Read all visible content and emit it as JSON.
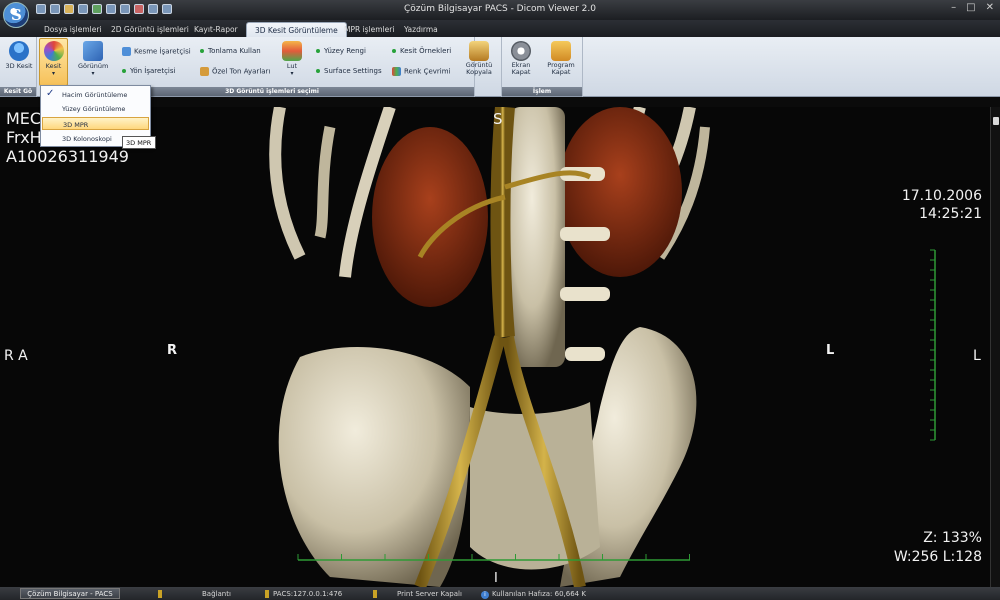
{
  "window": {
    "title": "Çözüm Bilgisayar PACS - Dicom Viewer 2.0",
    "controls": [
      "–",
      "□",
      "✕"
    ]
  },
  "tabs": [
    {
      "label": "Dosya işlemleri",
      "active": false
    },
    {
      "label": "2D Görüntü işlemleri",
      "active": false
    },
    {
      "label": "Kayıt-Rapor",
      "active": false
    },
    {
      "label": "3D Kesit Görüntüleme",
      "active": true
    },
    {
      "label": "MPR işlemleri",
      "active": false
    },
    {
      "label": "Yazdırma",
      "active": false
    }
  ],
  "ribbon": {
    "btn_3d_kesit": "3D Kesit",
    "btn_kesit": "Kesit",
    "btn_gorunum": "Görünüm",
    "kesme_isaretcisi": "Kesme İşaretçisi",
    "yon_isaretcisi": "Yön İşaretçisi",
    "tonlama_kullan": "Tonlama Kullan",
    "ozel_ton_ayarlari": "Özel Ton Ayarları",
    "btn_lut": "Lut",
    "yuzey_rengi": "Yüzey Rengi",
    "surface_settings": "Surface Settings",
    "kesit_ornekleri": "Kesit Örnekleri",
    "renk_cevrimi": "Renk Çevrimi",
    "btn_goruntu_kopyala": "Görüntü Kopyala",
    "btn_ekran_kapat": "Ekran Kapat",
    "btn_program_kapat": "Program Kapat",
    "group_kesit_label": "Kesit Gö",
    "group_3d_label": "3D Görüntü işlemleri seçimi",
    "group_islem_label": "İşlem"
  },
  "dropdown": {
    "items": [
      {
        "label": "Hacim Görüntüleme",
        "checked": true
      },
      {
        "label": "Yüzey Görüntüleme",
        "checked": false
      },
      {
        "label": "3D MPR",
        "checked": false,
        "hover": true
      },
      {
        "label": "3D Kolonoskopi",
        "checked": false
      }
    ],
    "tooltip": "3D MPR"
  },
  "viewer": {
    "patient_name": "MECA",
    "patient_id_short": "FrxH",
    "accession": "A10026311949",
    "date": "17.10.2006",
    "time": "14:25:21",
    "zoom": "Z: 133%",
    "window_level": "W:256 L:128",
    "orient_top": "S",
    "orient_bottom": "I",
    "orient_left_edge": "R A",
    "orient_left_inner": "R",
    "orient_right_inner": "L",
    "orient_right_edge": "L"
  },
  "statusbar": {
    "app_button": "Çözüm Bilgisayar - PACS",
    "connection": "Bağlantı",
    "pacs_address": "PACS:127.0.0.1:476",
    "print_server": "Print Server Kapalı",
    "memory": "Kullanılan Hafıza: 60,664 K"
  },
  "colors": {
    "accent": "#f6c15a",
    "ruler": "#2e9a35",
    "bone": "#d9d2bd",
    "vessel": "#b08a2a",
    "kidney": "#7a2a12"
  }
}
